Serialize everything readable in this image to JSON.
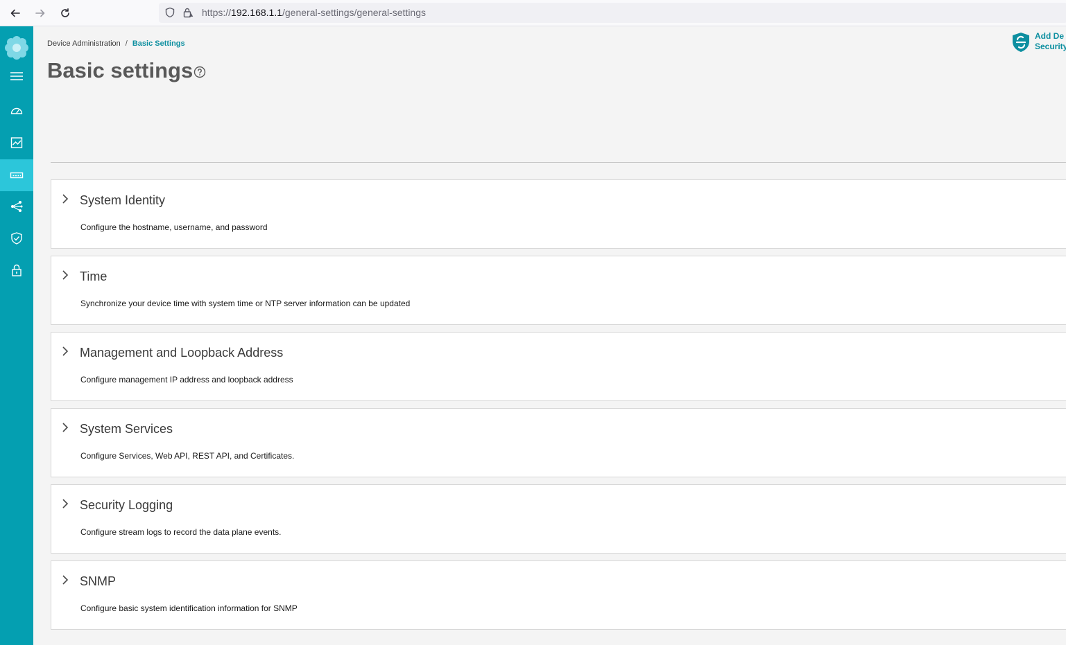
{
  "browser": {
    "url_scheme": "https://",
    "url_host": "192.168.1.1",
    "url_path": "/general-settings/general-settings"
  },
  "sidebar": {
    "accent": "#049fb1",
    "items": [
      {
        "name": "menu",
        "icon": "hamburger-icon"
      },
      {
        "name": "dashboard",
        "icon": "gauge-icon"
      },
      {
        "name": "monitoring",
        "icon": "chart-icon"
      },
      {
        "name": "device",
        "icon": "device-icon",
        "active": true
      },
      {
        "name": "network",
        "icon": "share-icon"
      },
      {
        "name": "security",
        "icon": "shield-check-icon"
      },
      {
        "name": "lock",
        "icon": "lock-icon"
      }
    ]
  },
  "breadcrumb": {
    "parent": "Device Administration",
    "separator": "/",
    "current": "Basic Settings"
  },
  "page": {
    "title": "Basic settings"
  },
  "add_device": {
    "line1": "Add De",
    "line2": "Security"
  },
  "panels": [
    {
      "title": "System Identity",
      "description": "Configure the hostname, username, and password"
    },
    {
      "title": "Time",
      "description": "Synchronize your device time with system time or NTP server information can be updated"
    },
    {
      "title": "Management and Loopback Address",
      "description": "Configure management IP address and loopback address"
    },
    {
      "title": "System Services",
      "description": "Configure Services, Web API, REST API, and Certificates."
    },
    {
      "title": "Security Logging",
      "description": "Configure stream logs to record the data plane events."
    },
    {
      "title": "SNMP",
      "description": "Configure basic system identification information for SNMP"
    }
  ]
}
